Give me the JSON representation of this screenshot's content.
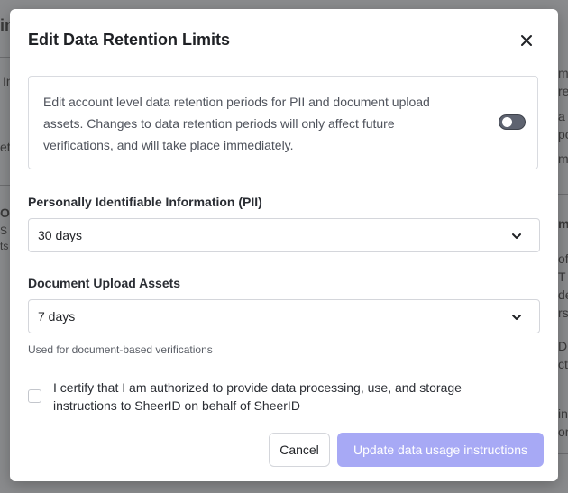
{
  "background": {
    "fragments": [
      "in",
      "In",
      "et",
      "O",
      "S",
      "ts",
      "m",
      "re",
      "a",
      "po",
      "m",
      "mp",
      "of",
      "T",
      "de",
      "rs",
      "D",
      "cti",
      "in",
      "orm"
    ]
  },
  "modal": {
    "title": "Edit Data Retention Limits",
    "close_icon": "close-icon",
    "info": {
      "text": "Edit account level data retention periods for PII and document upload assets. Changes to data retention periods will only affect future verifications, and will take place immediately.",
      "toggle_state": "off"
    },
    "pii": {
      "label": "Personally Identifiable Information (PII)",
      "value": "30 days"
    },
    "document": {
      "label": "Document Upload Assets",
      "value": "7 days",
      "helper": "Used for document-based verifications"
    },
    "certify": {
      "checked": false,
      "label": "I certify that I am authorized to provide data processing, use, and storage instructions to SheerID on behalf of SheerID"
    },
    "buttons": {
      "cancel": "Cancel",
      "submit": "Update data usage instructions"
    }
  },
  "colors": {
    "primary_disabled": "#a7a9f5",
    "toggle_off": "#5e6370"
  }
}
